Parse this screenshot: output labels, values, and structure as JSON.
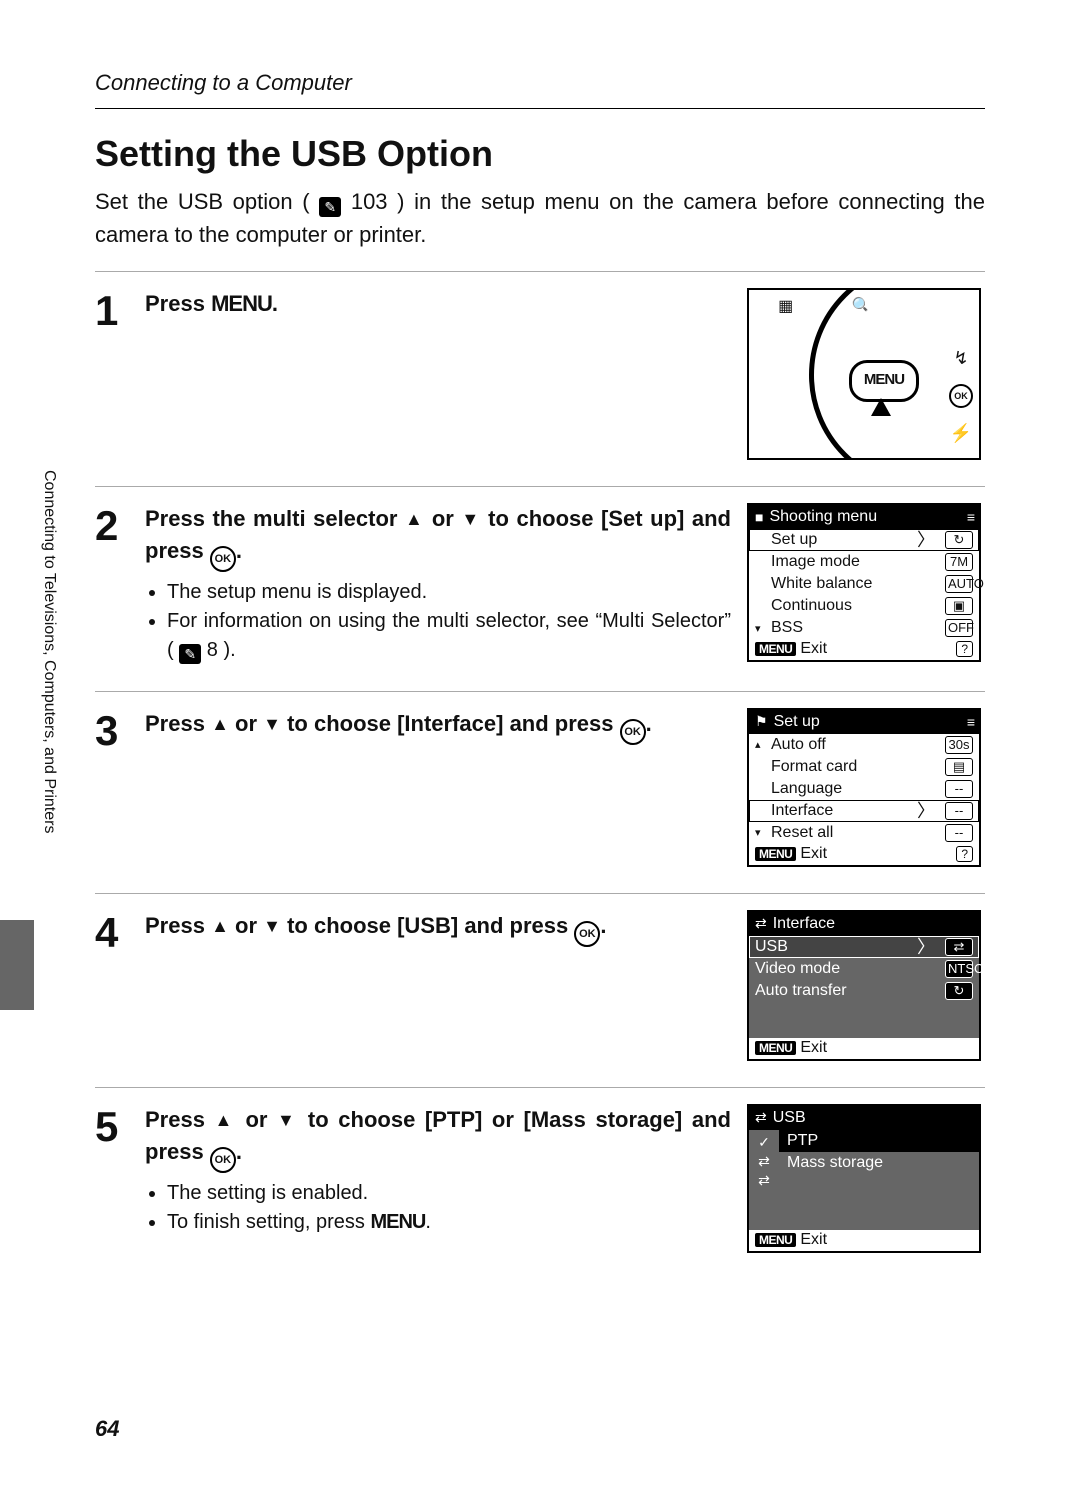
{
  "header": "Connecting to a Computer",
  "title": "Setting the USB Option",
  "intro_pre": "Set the USB option (",
  "intro_ref": "103",
  "intro_post": ") in the setup menu on the camera before connecting the camera to the computer or printer.",
  "side_label": "Connecting to Televisions, Computers, and Printers",
  "page_number": "64",
  "menu_label": "MENU",
  "ok_label": "OK",
  "steps": {
    "s1": {
      "num": "1",
      "head_pre": "Press ",
      "head_post": "."
    },
    "s2": {
      "num": "2",
      "head_a": "Press the multi selector ",
      "head_b": " or ",
      "head_c": " to choose [Set up] and press ",
      "head_d": ".",
      "b1": "The setup menu is displayed.",
      "b2_a": "For information on using the multi selector, see “Multi Selector” (",
      "b2_ref": "8",
      "b2_b": ")."
    },
    "s3": {
      "num": "3",
      "head_a": "Press ",
      "head_b": " or ",
      "head_c": " to choose [Interface] and press ",
      "head_d": "."
    },
    "s4": {
      "num": "4",
      "head_a": "Press ",
      "head_b": " or ",
      "head_c": " to choose [USB] and press ",
      "head_d": "."
    },
    "s5": {
      "num": "5",
      "head_a": "Press ",
      "head_b": " or ",
      "head_c": " to choose [PTP] or [Mass storage] and press ",
      "head_d": ".",
      "b1": "The setting is enabled.",
      "b2_a": "To finish setting, press ",
      "b2_b": "."
    }
  },
  "lcd_exit": "Exit",
  "lcd_menu_tag": "MENU",
  "lcd_q": "?",
  "lcd2": {
    "title": "Shooting menu",
    "hicon": "■",
    "r1": "Set up",
    "i1": "↻",
    "r2": "Image mode",
    "i2": "7M",
    "r3": "White balance",
    "i3": "AUTO",
    "r4": "Continuous",
    "i4": "▣",
    "r5": "BSS",
    "i5": "OFF"
  },
  "lcd3": {
    "title": "Set up",
    "hicon": "⚑",
    "r1": "Auto off",
    "i1": "30s",
    "r2": "Format card",
    "i2": "▤",
    "r3": "Language",
    "i3": "‑‑",
    "r4": "Interface",
    "i4": "‑‑",
    "r5": "Reset all",
    "i5": "‑‑"
  },
  "lcd4": {
    "title": "Interface",
    "hicon": "⇄",
    "r1": "USB",
    "i1": "⇄",
    "r2": "Video mode",
    "i2": "NTSC",
    "r3": "Auto transfer",
    "i3": "↻"
  },
  "lcd5": {
    "title": "USB",
    "hicon": "⇄",
    "r1": "PTP",
    "r2": "Mass storage",
    "strip_check": "✓",
    "strip_i1": "⇄",
    "strip_i2": "⇄"
  }
}
